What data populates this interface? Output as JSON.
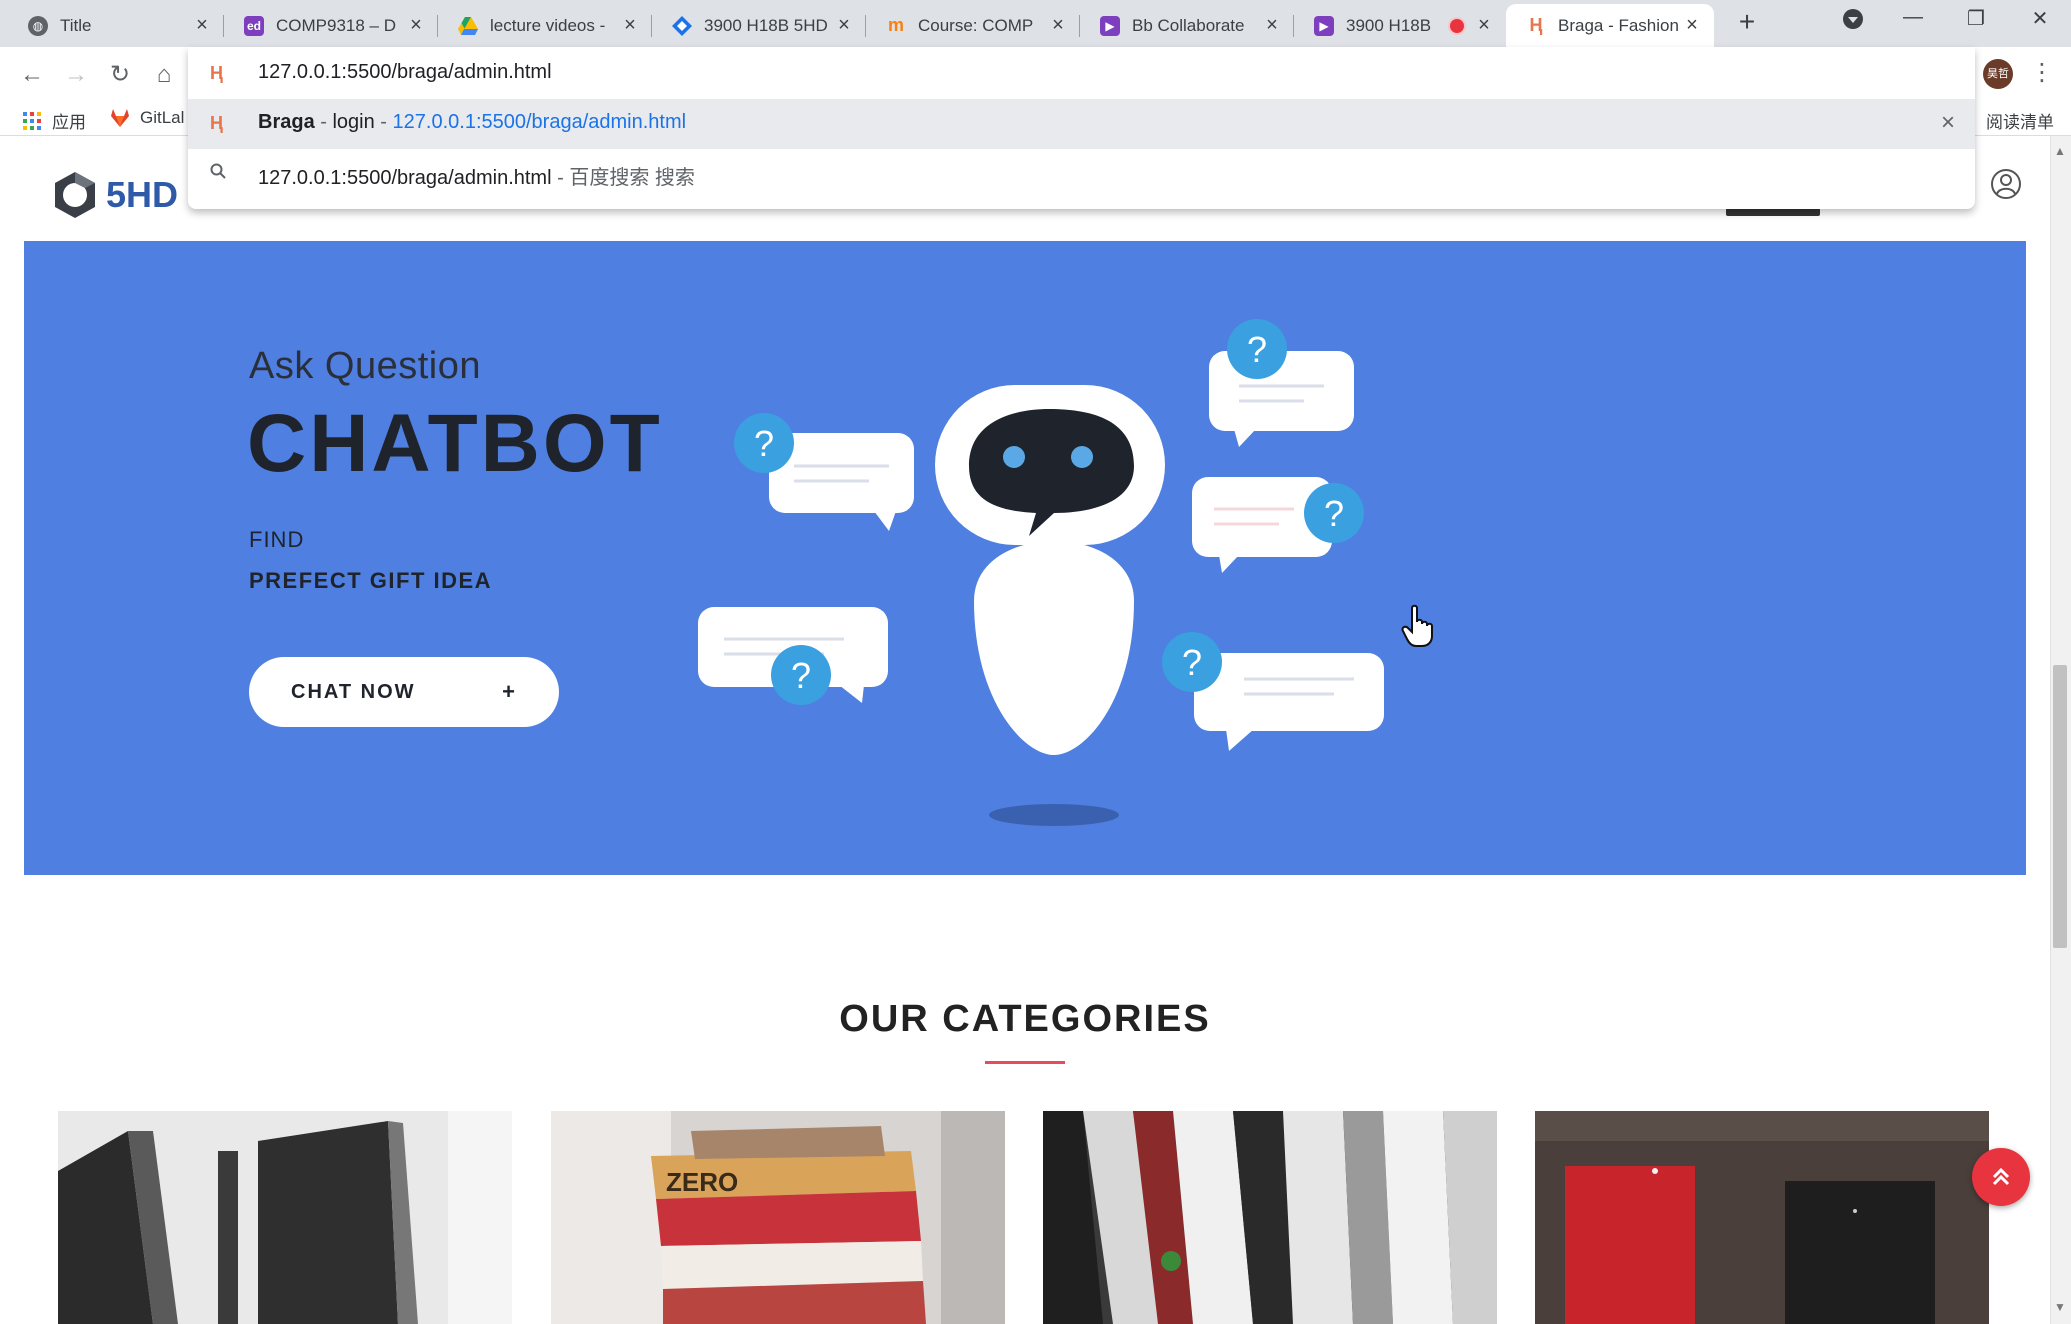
{
  "browser": {
    "tabs": [
      {
        "title": "Title",
        "favicon": "globe-icon",
        "color": "#5f6368"
      },
      {
        "title": "COMP9318 – D",
        "favicon": "ed-icon",
        "color": "#7e3fbf"
      },
      {
        "title": "lecture videos -",
        "favicon": "google-drive-icon",
        "color": "#1fa463"
      },
      {
        "title": "3900 H18B 5HD",
        "favicon": "diamond-icon",
        "color": "#1a73e8"
      },
      {
        "title": "Course: COMP",
        "favicon": "moodle-icon",
        "color": "#f98012"
      },
      {
        "title": "Bb Collaborate",
        "favicon": "collaborate-icon",
        "color": "#7e3fbf"
      },
      {
        "title": "3900 H18B",
        "favicon": "collaborate-icon",
        "color": "#7e3fbf"
      },
      {
        "title": "Braga - Fashion",
        "favicon": "braga-icon",
        "color": "#e8744b"
      }
    ],
    "address": "127.0.0.1:5500/braga/admin.html",
    "suggestions": [
      {
        "name": "Braga",
        "sep1": " - ",
        "page": "login",
        "sep2": " - ",
        "url": "127.0.0.1:5500/braga/admin.html"
      },
      {
        "query": "127.0.0.1:5500/braga/admin.html",
        "engine": " - 百度搜索 搜索"
      }
    ],
    "profile_initials": "昊哲",
    "bookmarks": [
      {
        "label": "应用",
        "icon": "apps-grid-icon"
      },
      {
        "label": "GitLal",
        "icon": "gitlab-icon"
      }
    ],
    "reading_list": "阅读清单"
  },
  "site": {
    "logo_text": "5HD",
    "hero": {
      "subtitle": "Ask Question",
      "title": "CHATBOT",
      "find": "FIND",
      "gift": "PREFECT GIFT IDEA",
      "button": "CHAT NOW",
      "button_icon": "+"
    },
    "categories_title": "OUR CATEGORIES",
    "categories": [
      {
        "image": "laptops-photo"
      },
      {
        "image": "books-photo"
      },
      {
        "image": "shirts-photo"
      },
      {
        "image": "tshirts-photo"
      }
    ],
    "back_to_top_icon": "chevron-up-double-icon"
  },
  "colors": {
    "hero_bg": "#4f7fe0",
    "accent": "#e84a5f",
    "back_to_top": "#e8343f"
  }
}
